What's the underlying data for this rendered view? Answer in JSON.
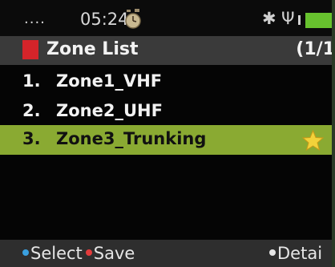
{
  "status": {
    "dots": "....",
    "time": "05:24",
    "icons": [
      "alarm-clock-icon",
      "bluetooth-icon",
      "usb-icon",
      "signal-icon",
      "battery-icon"
    ],
    "battery_color": "#67c22e"
  },
  "header": {
    "title": "Zone List",
    "page": "(1/1",
    "indicator_color": "#d4242a"
  },
  "zones": [
    {
      "number": "1.",
      "name": "Zone1_VHF",
      "selected": false
    },
    {
      "number": "2.",
      "name": "Zone2_UHF",
      "selected": false
    },
    {
      "number": "3.",
      "name": "Zone3_Trunking",
      "selected": true,
      "icon": "star-icon"
    }
  ],
  "softkeys": {
    "left_label": "Select",
    "middle_label": "Save",
    "right_label": "Detai"
  },
  "colors": {
    "selection": "#8aaa32",
    "select_dot": "#3aa0e0",
    "save_dot": "#e23b3b"
  }
}
